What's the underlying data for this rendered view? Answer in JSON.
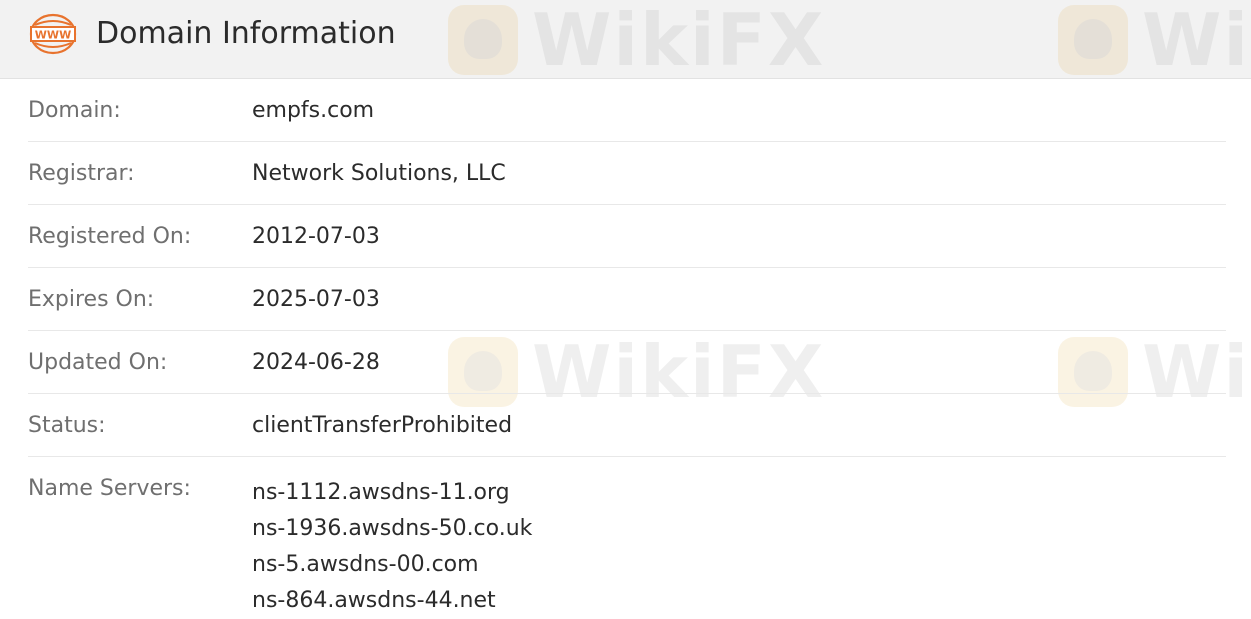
{
  "header": {
    "icon": "www-icon",
    "icon_text": "WWW",
    "title": "Domain Information"
  },
  "rows": [
    {
      "label": "Domain:",
      "value": "empfs.com"
    },
    {
      "label": "Registrar:",
      "value": "Network Solutions, LLC"
    },
    {
      "label": "Registered On:",
      "value": "2012-07-03"
    },
    {
      "label": "Expires On:",
      "value": "2025-07-03"
    },
    {
      "label": "Updated On:",
      "value": "2024-06-28"
    },
    {
      "label": "Status:",
      "value": "clientTransferProhibited"
    }
  ],
  "name_servers": {
    "label": "Name Servers:",
    "values": [
      "ns-1112.awsdns-11.org",
      "ns-1936.awsdns-50.co.uk",
      "ns-5.awsdns-00.com",
      "ns-864.awsdns-44.net"
    ]
  },
  "watermark": {
    "text": "WikiFX"
  },
  "colors": {
    "header_bg": "#f2f2f2",
    "icon_accent": "#e8732e",
    "label": "#6f6f6f",
    "value": "#2b2b2b",
    "divider": "#e8e8e8"
  }
}
